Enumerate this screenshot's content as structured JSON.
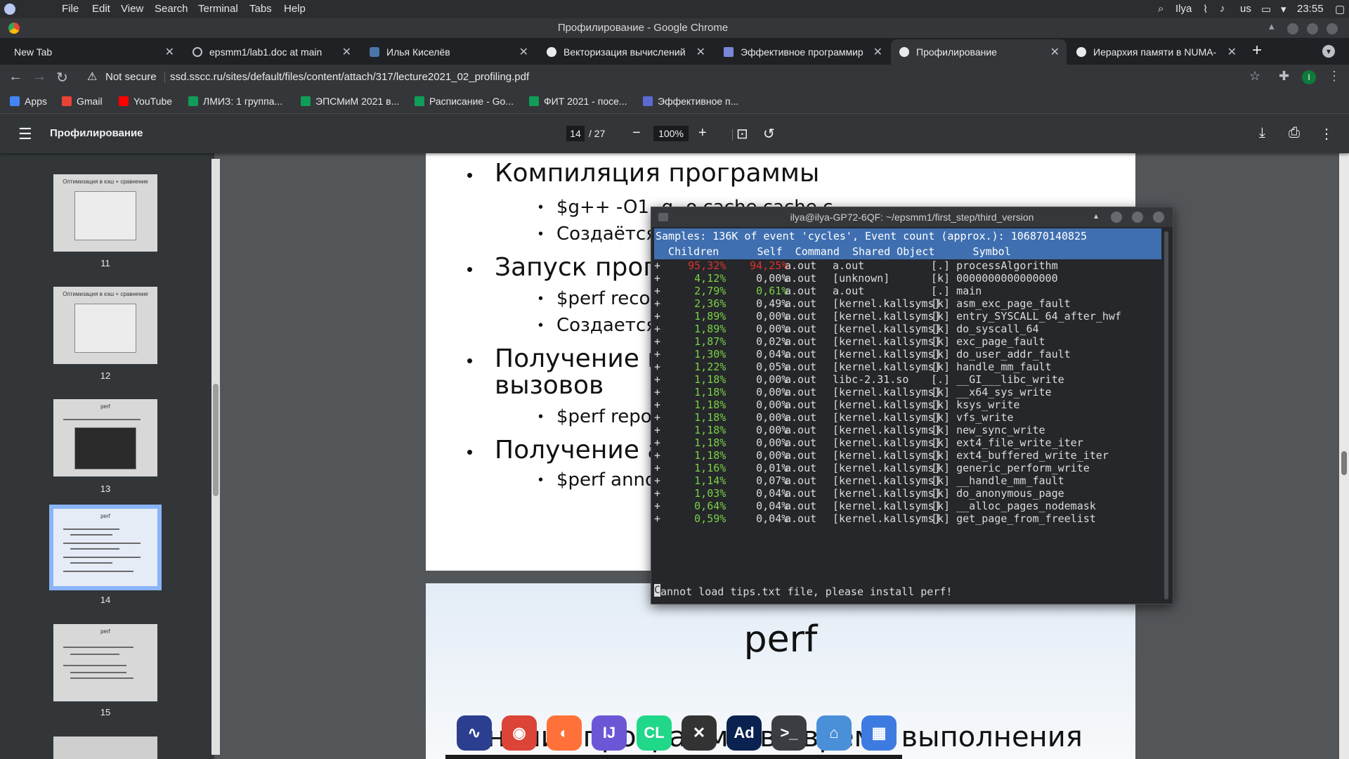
{
  "sysbar": {
    "menu": [
      "File",
      "Edit",
      "View",
      "Search",
      "Terminal",
      "Tabs",
      "Help"
    ],
    "user": "Ilya",
    "layout": "us",
    "time": "23:55"
  },
  "window": {
    "title": "Профилирование - Google Chrome"
  },
  "tabs": [
    {
      "label": "New Tab",
      "icon": "new-tab"
    },
    {
      "label": "epsmm1/lab1.doc at main",
      "icon": "github-icon"
    },
    {
      "label": "Илья Киселёв",
      "icon": "vk-icon"
    },
    {
      "label": "Векторизация вычислений",
      "icon": "globe-icon"
    },
    {
      "label": "Эффективное программир",
      "icon": "grid-icon"
    },
    {
      "label": "Профилирование",
      "icon": "globe-icon"
    },
    {
      "label": "Иерархия памяти в NUMA-",
      "icon": "globe-icon"
    }
  ],
  "omnibox": {
    "security": "Not secure",
    "url": "ssd.sscc.ru/sites/default/files/content/attach/317/lecture2021_02_profiling.pdf"
  },
  "bookmarks": [
    {
      "label": "Apps",
      "color": "#4285f4"
    },
    {
      "label": "Gmail",
      "color": "#ea4335"
    },
    {
      "label": "YouTube",
      "color": "#ff0000"
    },
    {
      "label": "ЛМИЗ: 1 группа...",
      "color": "#0f9d58"
    },
    {
      "label": "ЭПСМиМ 2021 в...",
      "color": "#0f9d58"
    },
    {
      "label": "Расписание - Go...",
      "color": "#0f9d58"
    },
    {
      "label": "ФИТ 2021 - посе...",
      "color": "#0f9d58"
    },
    {
      "label": "Эффективное п...",
      "color": "#5b6ad0"
    }
  ],
  "pdf": {
    "title": "Профилирование",
    "page": "14",
    "total": "/ 27",
    "zoom": "100%",
    "thumbs": [
      {
        "num": "11",
        "title": "Оптимизация в кэш + сравнение"
      },
      {
        "num": "12",
        "title": "Оптимизация в кэш + сравнение"
      },
      {
        "num": "13",
        "title": "perf"
      },
      {
        "num": "14",
        "title": "perf"
      },
      {
        "num": "15",
        "title": "perf"
      }
    ],
    "page1": {
      "b1": "Компиляция программы",
      "b1a": "$g++ -O1 -g -o cache cache.c",
      "b1b": "Создаётся",
      "b2": "Запуск прогр",
      "b2a": "$perf reco",
      "b2b": "Создается",
      "b3": "Получение п",
      "b3cont": "вызовов",
      "b3a": "$perf repo",
      "b4": "Получение а",
      "b4a": "$perf anno"
    },
    "page2": {
      "title": "perf",
      "subtitle": "Анализ программы во время выполнения"
    }
  },
  "terminal": {
    "title": "ilya@ilya-GP72-6QF: ~/epsmm1/first_step/third_version",
    "samples": "Samples: 136K of event 'cycles', Event count (approx.): 106870140825",
    "header": "  Children      Self  Command  Shared Object      Symbol",
    "rows": [
      {
        "children": "95,32%",
        "self": "94,25%",
        "cmd": "a.out",
        "obj": "a.out",
        "sym": "[.] processAlgorithm",
        "hot": true
      },
      {
        "children": "4,12%",
        "self": "0,00%",
        "cmd": "a.out",
        "obj": "[unknown]",
        "sym": "[k] 0000000000000000"
      },
      {
        "children": "2,79%",
        "self": "0,61%",
        "cmd": "a.out",
        "obj": "a.out",
        "sym": "[.] main",
        "selfgreen": true
      },
      {
        "children": "2,36%",
        "self": "0,49%",
        "cmd": "a.out",
        "obj": "[kernel.kallsyms]",
        "sym": "[k] asm_exc_page_fault"
      },
      {
        "children": "1,89%",
        "self": "0,00%",
        "cmd": "a.out",
        "obj": "[kernel.kallsyms]",
        "sym": "[k] entry_SYSCALL_64_after_hwf"
      },
      {
        "children": "1,89%",
        "self": "0,00%",
        "cmd": "a.out",
        "obj": "[kernel.kallsyms]",
        "sym": "[k] do_syscall_64"
      },
      {
        "children": "1,87%",
        "self": "0,02%",
        "cmd": "a.out",
        "obj": "[kernel.kallsyms]",
        "sym": "[k] exc_page_fault"
      },
      {
        "children": "1,30%",
        "self": "0,04%",
        "cmd": "a.out",
        "obj": "[kernel.kallsyms]",
        "sym": "[k] do_user_addr_fault"
      },
      {
        "children": "1,22%",
        "self": "0,05%",
        "cmd": "a.out",
        "obj": "[kernel.kallsyms]",
        "sym": "[k] handle_mm_fault"
      },
      {
        "children": "1,18%",
        "self": "0,00%",
        "cmd": "a.out",
        "obj": "libc-2.31.so",
        "sym": "[.] __GI___libc_write"
      },
      {
        "children": "1,18%",
        "self": "0,00%",
        "cmd": "a.out",
        "obj": "[kernel.kallsyms]",
        "sym": "[k] __x64_sys_write"
      },
      {
        "children": "1,18%",
        "self": "0,00%",
        "cmd": "a.out",
        "obj": "[kernel.kallsyms]",
        "sym": "[k] ksys_write"
      },
      {
        "children": "1,18%",
        "self": "0,00%",
        "cmd": "a.out",
        "obj": "[kernel.kallsyms]",
        "sym": "[k] vfs_write"
      },
      {
        "children": "1,18%",
        "self": "0,00%",
        "cmd": "a.out",
        "obj": "[kernel.kallsyms]",
        "sym": "[k] new_sync_write"
      },
      {
        "children": "1,18%",
        "self": "0,00%",
        "cmd": "a.out",
        "obj": "[kernel.kallsyms]",
        "sym": "[k] ext4_file_write_iter"
      },
      {
        "children": "1,18%",
        "self": "0,00%",
        "cmd": "a.out",
        "obj": "[kernel.kallsyms]",
        "sym": "[k] ext4_buffered_write_iter"
      },
      {
        "children": "1,16%",
        "self": "0,01%",
        "cmd": "a.out",
        "obj": "[kernel.kallsyms]",
        "sym": "[k] generic_perform_write"
      },
      {
        "children": "1,14%",
        "self": "0,07%",
        "cmd": "a.out",
        "obj": "[kernel.kallsyms]",
        "sym": "[k] __handle_mm_fault"
      },
      {
        "children": "1,03%",
        "self": "0,04%",
        "cmd": "a.out",
        "obj": "[kernel.kallsyms]",
        "sym": "[k] do_anonymous_page"
      },
      {
        "children": "0,64%",
        "self": "0,04%",
        "cmd": "a.out",
        "obj": "[kernel.kallsyms]",
        "sym": "[k] __alloc_pages_nodemask"
      },
      {
        "children": "0,59%",
        "self": "0,04%",
        "cmd": "a.out",
        "obj": "[kernel.kallsyms]",
        "sym": "[k] get_page_from_freelist"
      }
    ],
    "status": "annot load tips.txt file, please install perf!",
    "status_first": "C"
  },
  "dock": [
    {
      "name": "system-monitor-icon",
      "color": "#2c3e8f",
      "glyph": "∿"
    },
    {
      "name": "chrome-icon",
      "color": "#db4437",
      "glyph": "◉"
    },
    {
      "name": "firefox-icon",
      "color": "#ff7139",
      "glyph": "◐"
    },
    {
      "name": "intellij-icon",
      "color": "#6b57d6",
      "glyph": "IJ"
    },
    {
      "name": "clion-icon",
      "color": "#21d789",
      "glyph": "CL"
    },
    {
      "name": "xmind-icon",
      "color": "#333333",
      "glyph": "✕"
    },
    {
      "name": "adobe-dimension-icon",
      "color": "#0a2250",
      "glyph": "Ad"
    },
    {
      "name": "terminal-icon",
      "color": "#3a3d42",
      "glyph": ">_"
    },
    {
      "name": "files-icon",
      "color": "#4a90d9",
      "glyph": "⌂"
    },
    {
      "name": "app-grid-icon",
      "color": "#3d7be0",
      "glyph": "▦"
    }
  ]
}
